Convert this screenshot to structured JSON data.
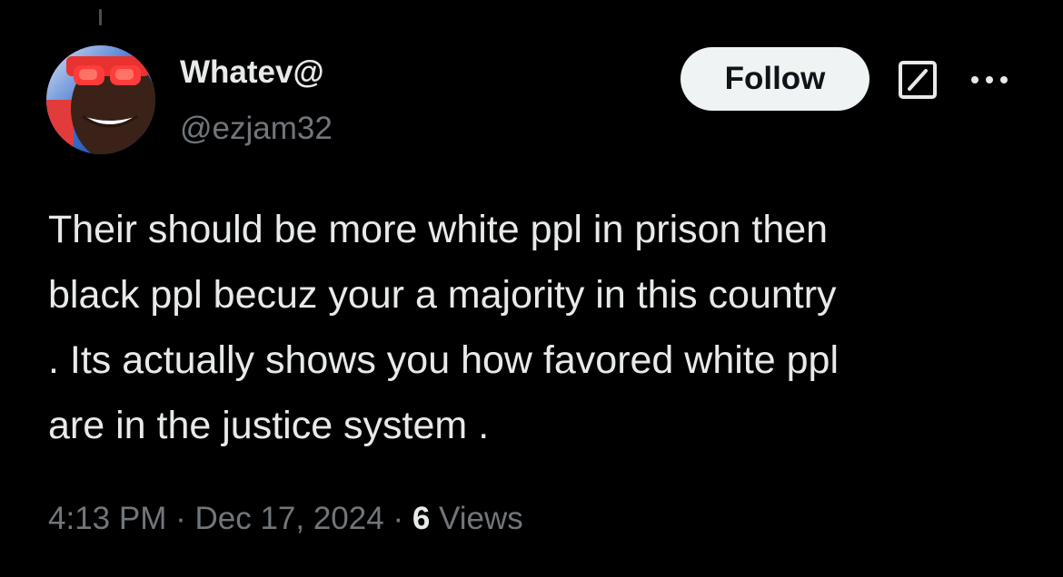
{
  "tweet": {
    "display_name": "Whatev@",
    "handle": "@ezjam32",
    "follow_label": "Follow",
    "text_lines": [
      "Their should be more white ppl in prison then",
      "black ppl becuz your a majority in this country",
      ". Its actually shows you how favored white ppl",
      "are in the justice system ."
    ],
    "time": "4:13 PM",
    "separator": "·",
    "date": "Dec 17, 2024",
    "views_count": "6",
    "views_label": "Views"
  },
  "icons": {
    "grok": "grok-icon",
    "more": "more-options-icon",
    "avatar": "user-avatar"
  },
  "colors": {
    "background": "#000000",
    "primary_text": "#e7e9ea",
    "secondary_text": "#71767b",
    "follow_button_bg": "#eff3f4",
    "follow_button_text": "#0f1419"
  }
}
